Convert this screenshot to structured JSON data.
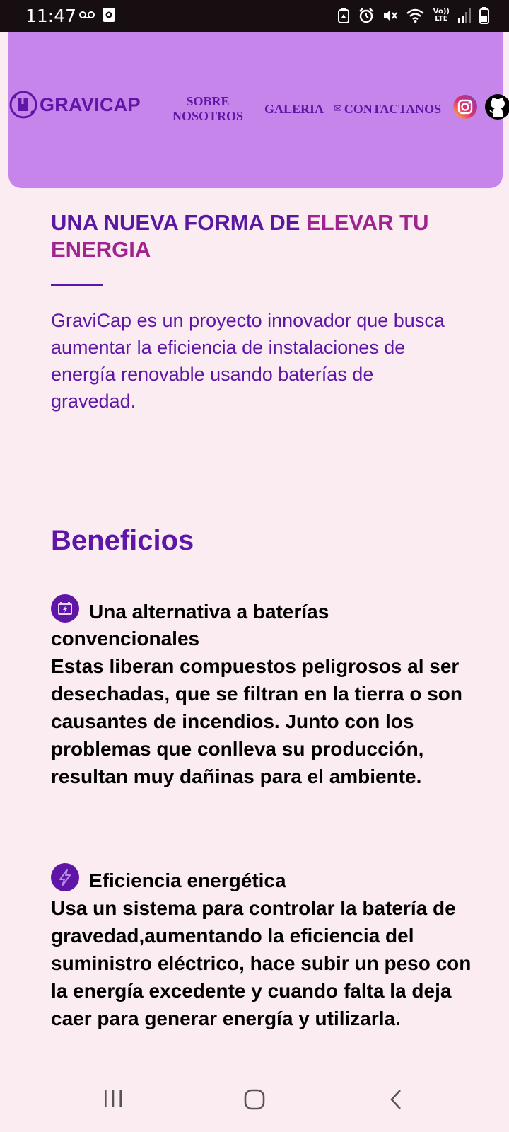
{
  "status_bar": {
    "time": "11:47",
    "icons": [
      "voicemail-icon",
      "photo-icon",
      "battery-saver-icon",
      "alarm-icon",
      "mute-icon",
      "wifi-icon",
      "lte-icon",
      "signal-icon",
      "battery-icon"
    ],
    "lte_top": "Vo))",
    "lte_bottom": "LTE"
  },
  "header": {
    "logo_text": "GRAVICAP",
    "nav": {
      "sobre": "SOBRE NOSOTROS",
      "galeria": "GALERIA",
      "contact_icon": "✉",
      "contactanos": "CONTACTANOS"
    },
    "social": [
      "instagram-icon",
      "github-icon"
    ]
  },
  "hero": {
    "title_part1": "UNA NUEVA FORMA DE ",
    "title_part2": "ELEVAR TU ENERGIA",
    "description": "GraviCap es un proyecto innovador que busca aumentar la eficiencia de instalaciones de energía renovable usando baterías de gravedad."
  },
  "benefits": {
    "title": "Beneficios",
    "items": [
      {
        "icon": "battery-icon",
        "heading": "Una alternativa a baterías convencionales",
        "body": "Estas liberan compuestos peligrosos al ser desechadas, que se filtran en la tierra o son causantes de incendios. Junto con los problemas que conlleva su producción, resultan muy dañinas para el ambiente."
      },
      {
        "icon": "lightning-icon",
        "heading": "Eficiencia energética",
        "body": "Usa un sistema para controlar la batería de gravedad,aumentando la eficiencia del suministro eléctrico, hace subir un peso con la energía excedente y cuando falta la deja caer para generar energía y utilizarla."
      }
    ]
  },
  "colors": {
    "background": "#fbecf2",
    "nav_card": "#c685ea",
    "primary": "#5f15a5",
    "accent": "#a0248f",
    "status_bar": "#160e10"
  }
}
